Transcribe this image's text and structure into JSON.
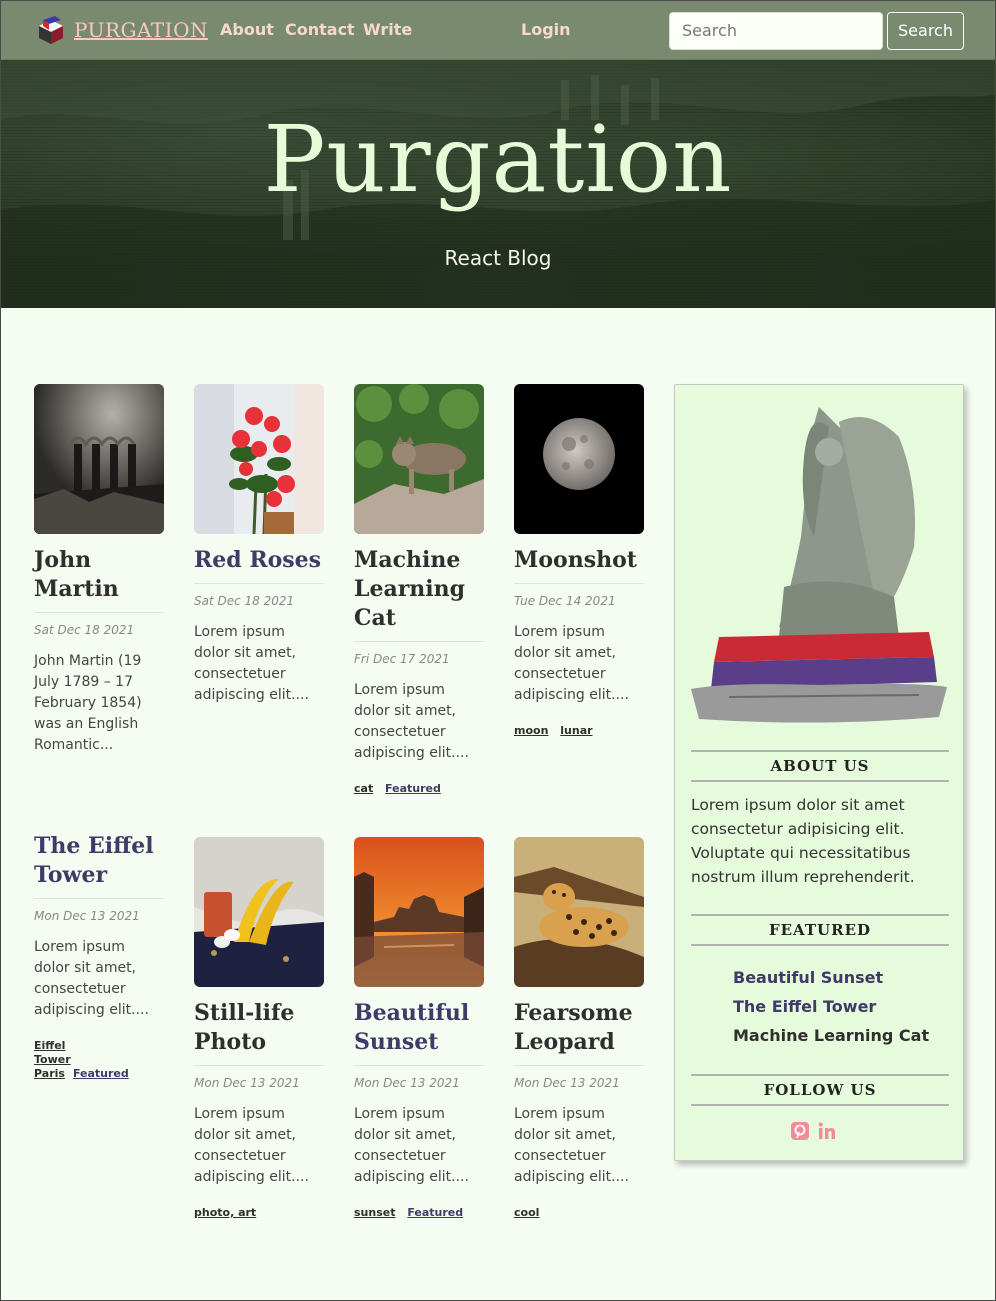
{
  "nav": {
    "brand": "PURGATION",
    "links": [
      "About",
      "Contact",
      "Write"
    ],
    "login": "Login",
    "search_placeholder": "Search",
    "search_button": "Search"
  },
  "hero": {
    "title": "Purgation",
    "subtitle": "React Blog"
  },
  "posts": [
    {
      "title": "John Martin",
      "date": "Sat Dec 18 2021",
      "desc": "John Martin (19 July 1789 – 17 February 1854) was an English Romantic...",
      "tags": [],
      "image": "dark-ruins-painting"
    },
    {
      "title": "Red Roses",
      "date": "Sat Dec 18 2021",
      "desc": "Lorem ipsum dolor sit amet, consectetuer adipiscing elit....",
      "tags": [],
      "image": "red-roses"
    },
    {
      "title": "Machine Learning Cat",
      "date": "Fri Dec 17 2021",
      "desc": "Lorem ipsum dolor sit amet, consectetuer adipiscing elit....",
      "tags": [
        "cat",
        "Featured"
      ],
      "image": "cat-on-rock"
    },
    {
      "title": "Moonshot",
      "date": "Tue Dec 14 2021",
      "desc": "Lorem ipsum dolor sit amet, consectetuer adipiscing elit....",
      "tags": [
        "moon",
        "lunar"
      ],
      "image": "moon"
    },
    {
      "title": "The Eiffel Tower",
      "date": "Mon Dec 13 2021",
      "desc": "Lorem ipsum dolor sit amet, consectetuer adipiscing elit....",
      "tags": [
        "Eiffel Tower",
        "Paris",
        "Featured"
      ],
      "image": ""
    },
    {
      "title": "Still-life Photo",
      "date": "Mon Dec 13 2021",
      "desc": "Lorem ipsum dolor sit amet, consectetuer adipiscing elit....",
      "tags": [
        "photo, art"
      ],
      "image": "still-life-bananas"
    },
    {
      "title": "Beautiful Sunset",
      "date": "Mon Dec 13 2021",
      "desc": "Lorem ipsum dolor sit amet, consectetuer adipiscing elit....",
      "tags": [
        "sunset",
        "Featured"
      ],
      "image": "venice-sunset"
    },
    {
      "title": "Fearsome Leopard",
      "date": "Mon Dec 13 2021",
      "desc": "Lorem ipsum dolor sit amet, consectetuer adipiscing elit....",
      "tags": [
        "cool"
      ],
      "image": "leopard"
    }
  ],
  "sidebar": {
    "about_heading": "ABOUT US",
    "about_text": "Lorem ipsum dolor sit amet consectetur adipisicing elit. Voluptate qui necessitatibus nostrum illum reprehenderit.",
    "featured_heading": "FEATURED",
    "featured": [
      "Beautiful Sunset",
      "The Eiffel Tower",
      "Machine Learning Cat"
    ],
    "follow_heading": "FOLLOW US",
    "social": [
      "pinterest-icon",
      "linkedin-icon"
    ]
  },
  "colors": {
    "navbar": "#7a8a6e",
    "brand": "#f7c9c1",
    "accent_purple": "#3f3a67",
    "page_bg": "#f5fdf2",
    "sidebar_bg": "#e6fbdb",
    "social_pink": "#f28b9b"
  }
}
